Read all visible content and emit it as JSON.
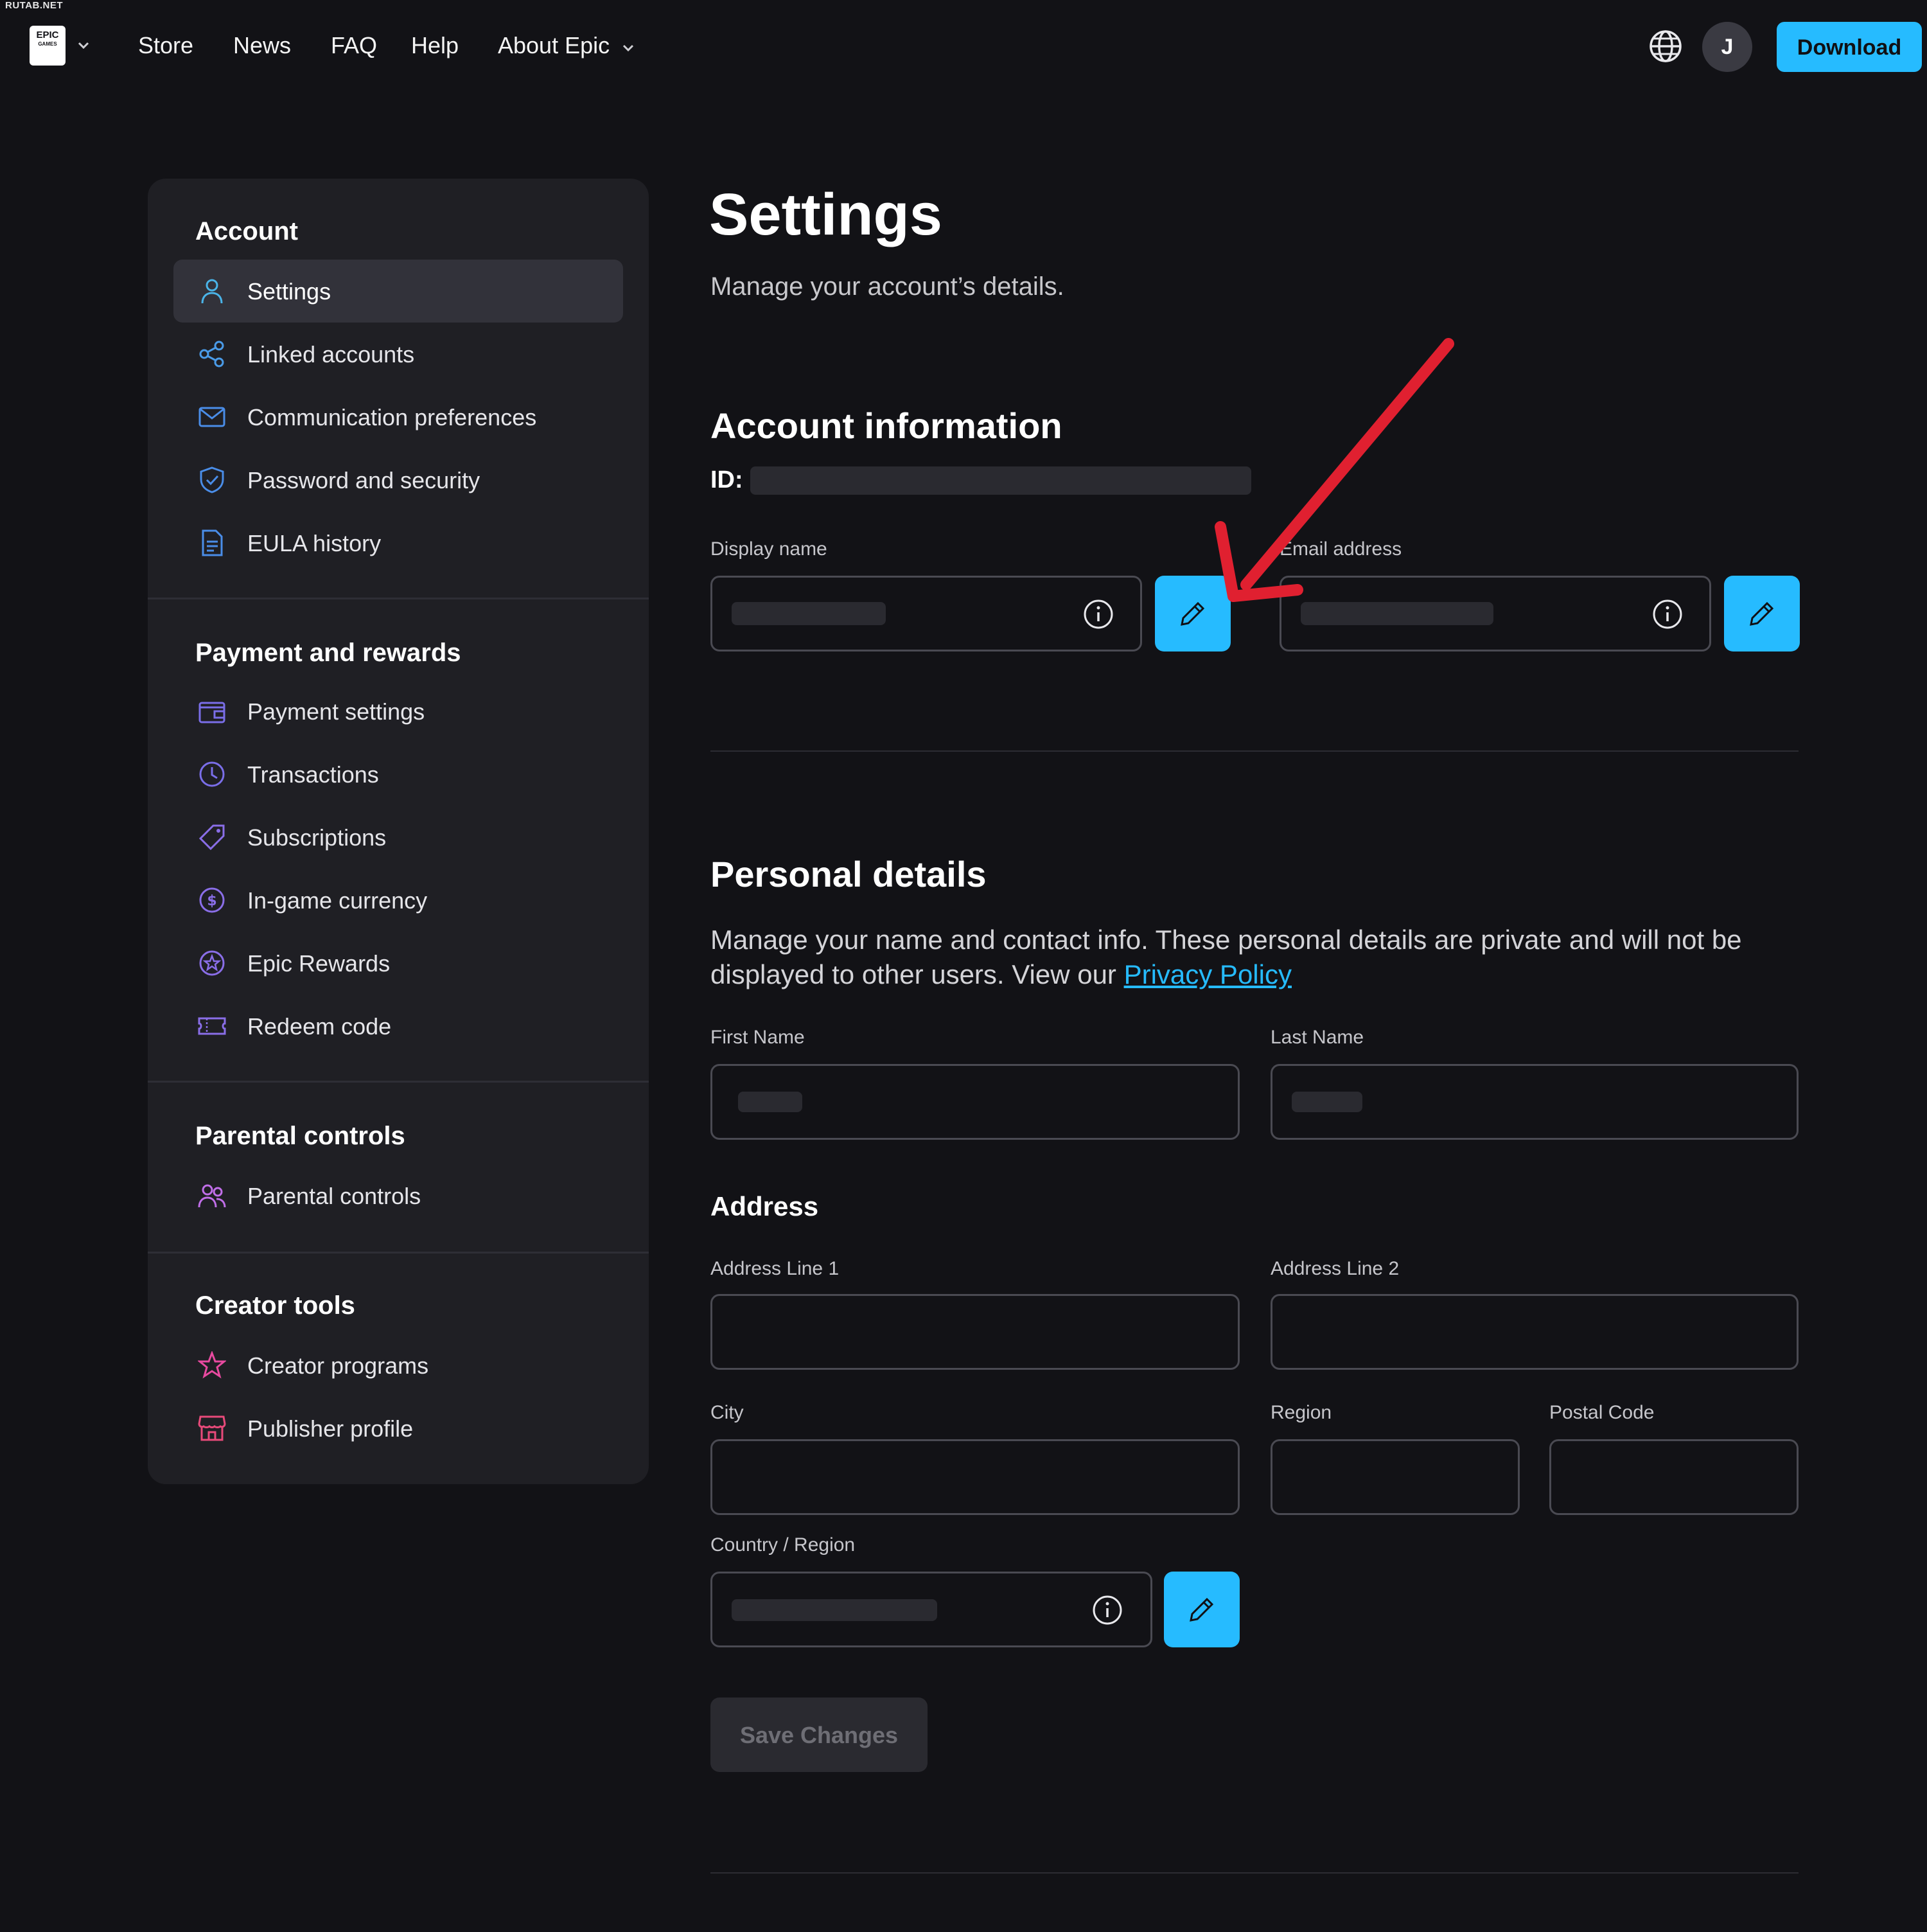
{
  "watermark": "RUTAB.NET",
  "logo": {
    "line1": "EPIC",
    "line2": "GAMES"
  },
  "nav": {
    "links": [
      "Store",
      "News",
      "FAQ",
      "Help",
      "About Epic"
    ],
    "avatar_initial": "J",
    "download_label": "Download"
  },
  "sidebar": {
    "sections": [
      {
        "title": "Account",
        "items": [
          {
            "label": "Settings",
            "icon": "person-icon",
            "active": true
          },
          {
            "label": "Linked accounts",
            "icon": "share-nodes-icon"
          },
          {
            "label": "Communication preferences",
            "icon": "mail-icon"
          },
          {
            "label": "Password and security",
            "icon": "shield-icon"
          },
          {
            "label": "EULA history",
            "icon": "document-icon"
          }
        ]
      },
      {
        "title": "Payment and rewards",
        "items": [
          {
            "label": "Payment settings",
            "icon": "wallet-icon"
          },
          {
            "label": "Transactions",
            "icon": "clock-icon"
          },
          {
            "label": "Subscriptions",
            "icon": "tag-icon"
          },
          {
            "label": "In-game currency",
            "icon": "dollar-coin-icon"
          },
          {
            "label": "Epic Rewards",
            "icon": "star-badge-icon"
          },
          {
            "label": "Redeem code",
            "icon": "ticket-icon"
          }
        ]
      },
      {
        "title": "Parental controls",
        "items": [
          {
            "label": "Parental controls",
            "icon": "people-icon"
          }
        ]
      },
      {
        "title": "Creator tools",
        "items": [
          {
            "label": "Creator programs",
            "icon": "star-icon"
          },
          {
            "label": "Publisher profile",
            "icon": "storefront-icon"
          }
        ]
      }
    ]
  },
  "main": {
    "title": "Settings",
    "subtitle": "Manage your account’s details.",
    "account_info": {
      "title": "Account information",
      "id_label": "ID:",
      "display_name_label": "Display name",
      "email_label": "Email address"
    },
    "personal": {
      "title": "Personal details",
      "description": "Manage your name and contact info. These personal details are private and will not be displayed to other users. View our ",
      "privacy_link": "Privacy Policy",
      "first_name_label": "First Name",
      "last_name_label": "Last Name"
    },
    "address": {
      "title": "Address",
      "line1_label": "Address Line 1",
      "line2_label": "Address Line 2",
      "city_label": "City",
      "region_label": "Region",
      "postal_label": "Postal Code",
      "country_label": "Country / Region"
    },
    "save_label": "Save Changes"
  },
  "colors": {
    "background": "#121216",
    "sidebar": "#1f1f24",
    "accent": "#26bbff",
    "annotation_arrow": "#e02030"
  }
}
